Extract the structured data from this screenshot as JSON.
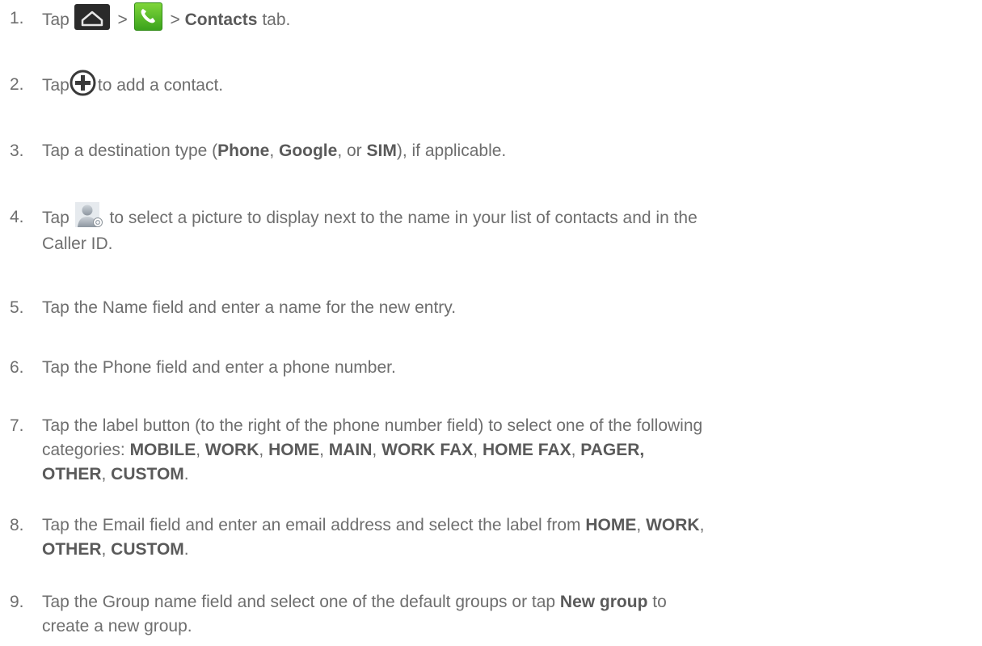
{
  "steps": [
    {
      "n": "1.",
      "tap": "Tap",
      "sep1": ">",
      "sep2": ">",
      "bold": "Contacts",
      "rest": "tab."
    },
    {
      "n": "2.",
      "tap": "Tap",
      "rest": "to add a contact."
    },
    {
      "n": "3.",
      "pre": "Tap a destination type (",
      "b1": "Phone",
      "c1": ", ",
      "b2": "Google",
      "c2": ", or ",
      "b3": "SIM",
      "post": "), if applicable."
    },
    {
      "n": "4.",
      "tap": "Tap",
      "line1": "to select a picture to display next to the name in your list of contacts and in the",
      "line2": "Caller ID."
    },
    {
      "n": "5.",
      "text": "Tap the Name field and enter a name for the new entry."
    },
    {
      "n": "6.",
      "text": "Tap the Phone field and enter a phone number."
    },
    {
      "n": "7.",
      "pre": "Tap the label button (to the right of the phone number field) to select one of the following",
      "pre2": "categories: ",
      "cats": [
        "MOBILE",
        "WORK",
        "HOME",
        "MAIN",
        "WORK FAX",
        "HOME FAX",
        "PAGER,",
        "OTHER",
        "CUSTOM"
      ],
      "end": "."
    },
    {
      "n": "8.",
      "pre": "Tap the Email field and enter an email address and select the label from ",
      "cats": [
        "HOME",
        "WORK",
        "OTHER",
        "CUSTOM"
      ],
      "end": "."
    },
    {
      "n": "9.",
      "pre": "Tap the Group name field and select one of the default groups or tap ",
      "bold": "New group",
      "post": " to",
      "line2": "create a new group."
    }
  ],
  "icons": {
    "home": "home-icon",
    "phone": "phone-app-icon",
    "add": "add-contact-icon",
    "picture": "contact-picture-icon",
    "phone_green": "#4cbb22",
    "home_dark": "#2a2a2a"
  }
}
